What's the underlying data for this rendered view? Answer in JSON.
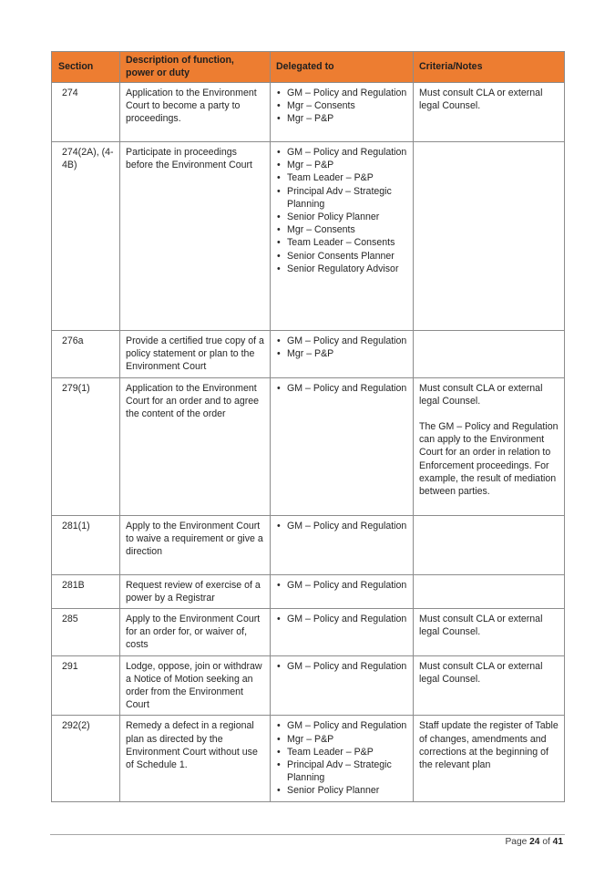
{
  "table": {
    "headers": {
      "section": "Section",
      "description": "Description of function, power or duty",
      "delegated_to": "Delegated to",
      "criteria": "Criteria/Notes"
    },
    "header_color": "#ed7d31",
    "rows": [
      {
        "section": "274",
        "description": "Application to the Environment Court to become a party to proceedings.",
        "delegated_to": [
          "GM – Policy and Regulation",
          "Mgr – Consents",
          "Mgr – P&P"
        ],
        "notes": [
          "Must consult CLA or external legal Counsel."
        ]
      },
      {
        "section": "274(2A), (4-4B)",
        "description": "Participate in proceedings before the Environment Court",
        "delegated_to": [
          "GM – Policy and Regulation",
          "Mgr – P&P",
          "Team Leader – P&P",
          "Principal Adv – Strategic Planning",
          "Senior Policy Planner",
          "Mgr – Consents",
          "Team Leader – Consents",
          "Senior Consents Planner",
          "Senior Regulatory Advisor"
        ],
        "notes": []
      },
      {
        "section": "276a",
        "description": "Provide a certified true copy of a policy statement or plan to the Environment Court",
        "delegated_to": [
          "GM – Policy and Regulation",
          "Mgr – P&P"
        ],
        "notes": []
      },
      {
        "section": "279(1)",
        "description": "Application to the Environment Court for an order and to agree the content of the order",
        "delegated_to": [
          "GM – Policy and Regulation"
        ],
        "notes": [
          "Must consult CLA or external legal Counsel.",
          "The GM – Policy and Regulation can apply to the Environment Court for an order in relation to Enforcement proceedings. For example, the result of mediation between parties."
        ]
      },
      {
        "section": "281(1)",
        "description": "Apply to the Environment Court to waive a requirement or give a direction",
        "delegated_to": [
          "GM – Policy and Regulation"
        ],
        "notes": []
      },
      {
        "section": "281B",
        "description": "Request review of exercise of a power by a Registrar",
        "delegated_to": [
          "GM – Policy and Regulation"
        ],
        "notes": []
      },
      {
        "section": "285",
        "description": "Apply to the Environment Court for an order for, or waiver of, costs",
        "delegated_to": [
          "GM – Policy and Regulation"
        ],
        "notes": [
          "Must consult CLA or external legal Counsel."
        ]
      },
      {
        "section": "291",
        "description": "Lodge, oppose, join or withdraw a Notice of Motion seeking an order from the Environment Court",
        "delegated_to": [
          "GM – Policy and Regulation"
        ],
        "notes": [
          "Must consult CLA or external legal Counsel."
        ]
      },
      {
        "section": "292(2)",
        "description": "Remedy a defect in a regional plan as directed by the Environment Court without use of Schedule 1.",
        "delegated_to": [
          "GM – Policy and Regulation",
          "Mgr – P&P",
          "Team Leader – P&P",
          "Principal Adv – Strategic Planning",
          "Senior Policy Planner"
        ],
        "notes": [
          "Staff update the register of Table of changes, amendments and corrections at the beginning of the relevant plan"
        ]
      }
    ]
  },
  "footer": {
    "page_prefix": "Page",
    "page_current": "24",
    "page_of": "of",
    "page_total": "41"
  },
  "icons": {
    "bullet": "•"
  }
}
